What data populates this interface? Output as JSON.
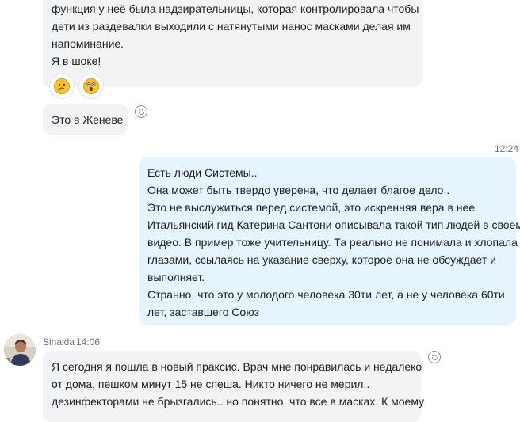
{
  "messages": {
    "top": {
      "lines": [
        "функция у неё была надзирательницы, которая контролировала чтобы",
        "дети из раздевалки выходили с натянутыми нанос масками делая им",
        "напоминание.",
        "Я в шоке!"
      ],
      "reactions": [
        "thinking-emoji",
        "surprised-emoji"
      ]
    },
    "geneva": {
      "text": "Это в Женеве"
    },
    "outgoing": {
      "time": "12:24",
      "lines": [
        "Есть люди Системы..",
        "Она может быть твердо уверена, что делает благое дело..",
        "Это не выслужиться перед системой, это искренняя вера в нее",
        "Итальянский гид Катерина Сантони описывала такой тип людей в своем",
        "видео. В пример тоже учительницу. Та реально не понимала и хлопала",
        "глазами, ссылаясь на указание сверху, которое она не обсуждает и",
        "выполняет.",
        "Странно, что это у молодого человека 30ти лет, а не у человека 60ти",
        "лет, заставшего Союз"
      ]
    },
    "sinaida": {
      "sender": "Sinaida",
      "time": "14:06",
      "lines": [
        "Я сегодня я пошла в новый праксис. Врач мне понравилась и недалеко",
        "от дома, пешком минут 15 не спеша. Никто ничего не мерил..",
        "дезинфекторами не брызгались.. но понятно, что все в масках. К моему"
      ]
    }
  },
  "colors": {
    "incoming_bubble": "#f2f3f5",
    "outgoing_bubble": "#e5f4fd",
    "meta_text": "#6b6f75"
  }
}
